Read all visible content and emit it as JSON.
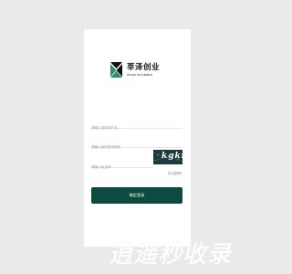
{
  "logo": {
    "name": "莘泽创业",
    "subtitle": "Xinze Incubator"
  },
  "login": {
    "username_placeholder": "请输入您的用户名",
    "password_placeholder": "请输入您的登录密码",
    "code_placeholder": "请输入验证码",
    "captcha_text": "kgki",
    "forgot_label": "忘记密码?",
    "submit_label": "确定登录"
  },
  "watermark": "逍遥秒收录",
  "colors": {
    "brand": "#0f4a40",
    "captcha_bg": "#1f3a3c",
    "background": "#eaeaea"
  }
}
